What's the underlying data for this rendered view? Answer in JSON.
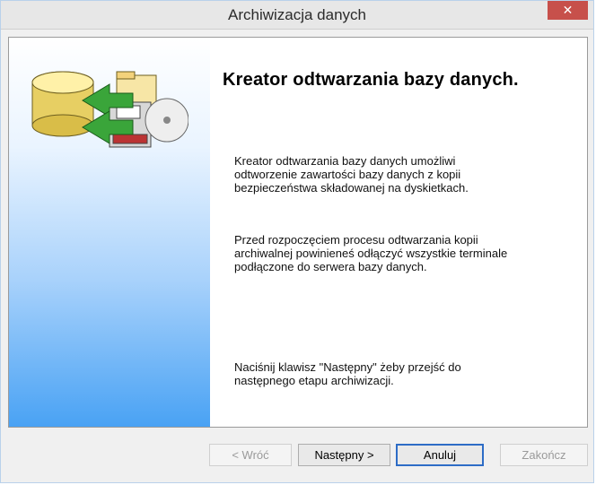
{
  "window": {
    "title": "Archiwizacja danych",
    "close_symbol": "✕"
  },
  "content": {
    "heading": "Kreator odtwarzania bazy danych.",
    "paragraph1": "   Kreator odtwarzania bazy danych umożliwi\nodtworzenie zawartości bazy danych z kopii\nbezpieczeństwa składowanej na dyskietkach.",
    "paragraph2": "  Przed rozpoczęciem procesu odtwarzania kopii\narchiwalnej powinieneś odłączyć wszystkie terminale\npodłączone do serwera bazy danych.",
    "paragraph3": "Naciśnij klawisz \"Następny\" żeby przejść do\nnastępnego etapu archiwizacji."
  },
  "buttons": {
    "back": "< Wróć",
    "next": "Następny >",
    "cancel": "Anuluj",
    "finish": "Zakończ"
  },
  "icons": {
    "wizard": "database-disk-restore-icon",
    "close": "close-icon"
  }
}
